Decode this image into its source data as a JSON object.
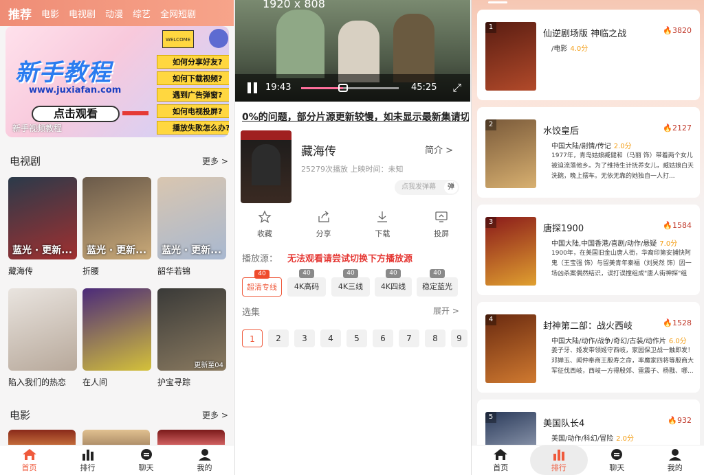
{
  "home": {
    "topnav": [
      "推荐",
      "电影",
      "电视剧",
      "动漫",
      "综艺",
      "全网短剧"
    ],
    "banner": {
      "welcome": "WELCOME",
      "title": "新手教程",
      "url": "www.juxiafan.com",
      "watch_button": "点击观看",
      "questions": [
        "如何分享好友?",
        "如何下载视频?",
        "遇到广告弹窗?",
        "如何电视投屏?",
        "播放失败怎么办?"
      ],
      "caption": "新手视频教程"
    },
    "tv_section": {
      "title": "电视剧",
      "more": "更多 >"
    },
    "tv_items": [
      {
        "name": "藏海传",
        "overlay": "蓝光 · 更新...",
        "color1": "#2b3a4a",
        "color2": "#a03030"
      },
      {
        "name": "折腰",
        "overlay": "蓝光 · 更新...",
        "color1": "#6a5a4a",
        "color2": "#c9a978"
      },
      {
        "name": "韶华若锦",
        "overlay": "蓝光 · 更新...",
        "color1": "#d9c6b0",
        "color2": "#a8b8d0"
      },
      {
        "name": "陷入我们的热恋",
        "overlay": "",
        "color1": "#e9e4df",
        "color2": "#b7a89a"
      },
      {
        "name": "在人间",
        "overlay": "",
        "color1": "#4b2a7a",
        "color2": "#d4c13a"
      },
      {
        "name": "护宝寻踪",
        "overlay": "更新至04",
        "color1": "#3a3a38",
        "color2": "#8a7a60"
      }
    ],
    "movie_section": {
      "title": "电影",
      "more": "更多 >"
    },
    "tabs": [
      "首页",
      "排行",
      "聊天",
      "我的"
    ]
  },
  "detail": {
    "resolution": "1920 x 808",
    "current_time": "19:43",
    "duration": "45:25",
    "progress": 0.43,
    "marquee": "0%的问题，部分片源更新较慢，如未显示最新集请切换",
    "title": "藏海传",
    "meta": "25279次播放  上映时间：未知",
    "intro": "简介 >",
    "danmu_placeholder": "点我发弹幕",
    "danmu_btn": "弹",
    "actions": [
      {
        "label": "收藏",
        "icon": "star-icon"
      },
      {
        "label": "分享",
        "icon": "share-icon"
      },
      {
        "label": "下载",
        "icon": "download-icon"
      },
      {
        "label": "投屏",
        "icon": "cast-icon"
      }
    ],
    "source_label": "播放源：",
    "source_message": "无法观看请尝试切换下方播放源",
    "sources": [
      {
        "label": "超清专线",
        "badge": "40"
      },
      {
        "label": "4K高码",
        "badge": "40"
      },
      {
        "label": "4K三线",
        "badge": "40"
      },
      {
        "label": "4K四线",
        "badge": "40"
      },
      {
        "label": "稳定蓝光",
        "badge": "40"
      }
    ],
    "episode_label": "选集",
    "episode_expand": "展开 >",
    "episodes": [
      "1",
      "2",
      "3",
      "4",
      "5",
      "6",
      "7",
      "8",
      "9"
    ]
  },
  "ranking": {
    "items": [
      {
        "rank": "1",
        "title": "仙逆剧场版 神临之战",
        "hot": "3820",
        "tags": "/电影",
        "score": "4.0分",
        "desc": "",
        "c1": "#5a1d12",
        "c2": "#b24a2a"
      },
      {
        "rank": "2",
        "title": "水饺皇后",
        "hot": "2127",
        "tags": "中国大陆/剧情/传记",
        "score": "2.0分",
        "desc": "1977年，青岛姑娘臧健和（马丽 饰）带着两个女儿被迫流落他乡。为了维持生计抚养女儿，臧姑娘白天洗碗，晚上摆车。无依无靠的她独自一人打...",
        "c1": "#7a5a3a",
        "c2": "#d8b070"
      },
      {
        "rank": "3",
        "title": "唐探1900",
        "hot": "1584",
        "tags": "中国大陆,中国香港/喜剧/动作/悬疑",
        "score": "7.0分",
        "desc": "1900年，在美国旧金山唐人街，华裔印第安捕快阿鬼（王宝强 饰）与留美青年秦福（刘昊然 饰）因一场凶杀案偶然结识，误打误撞组成\"唐人街神探\"组合...",
        "c1": "#8a1a1a",
        "c2": "#e0a030"
      },
      {
        "rank": "4",
        "title": "封神第二部：战火西岐",
        "hot": "1528",
        "tags": "中国大陆/动作/战争/奇幻/古装/动作片",
        "score": "6.0分",
        "desc": "姜子牙、姬发带领姬守西岐，家园保卫战一触即发！邓婵玉、闻仲奉商王殷寿之命，率魔家四将等殷商大军征伐西岐，西岐一方得殷郊、雷震子、杨戬、哪...",
        "c1": "#6a2a10",
        "c2": "#d07a30"
      },
      {
        "rank": "5",
        "title": "美国队长4",
        "hot": "932",
        "tags": "美国/动作/科幻/冒险",
        "score": "2.0分",
        "desc": "",
        "c1": "#2a3a5a",
        "c2": "#c0c8d8"
      }
    ],
    "tabs": [
      "首页",
      "排行",
      "聊天",
      "我的"
    ]
  }
}
